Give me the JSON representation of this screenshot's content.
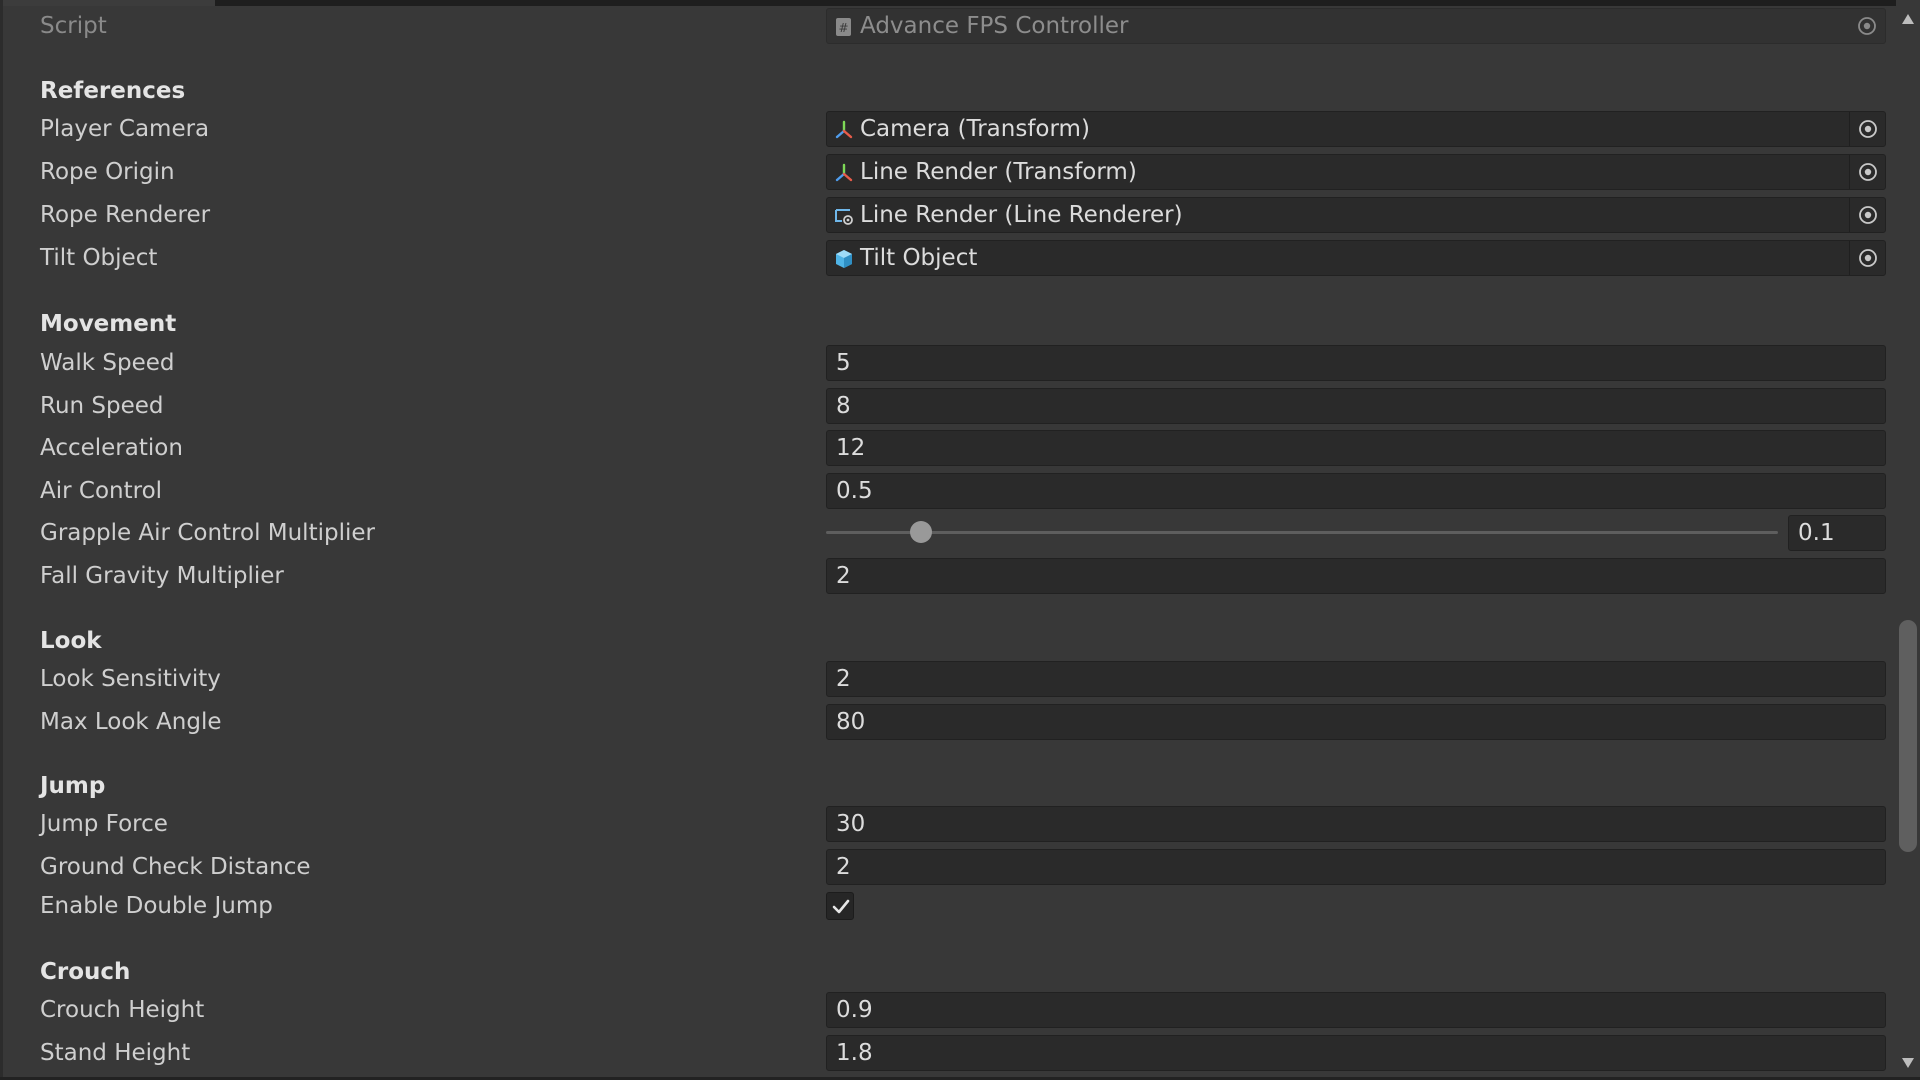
{
  "script": {
    "label": "Script",
    "value": "Advance FPS Controller",
    "icon": "script-icon"
  },
  "sections": {
    "references": {
      "header": "References",
      "player_camera": {
        "label": "Player Camera",
        "value": "Camera (Transform)",
        "icon": "transform-icon"
      },
      "rope_origin": {
        "label": "Rope Origin",
        "value": "Line Render (Transform)",
        "icon": "transform-icon"
      },
      "rope_renderer": {
        "label": "Rope Renderer",
        "value": "Line Render (Line Renderer)",
        "icon": "line-renderer-icon"
      },
      "tilt_object": {
        "label": "Tilt Object",
        "value": "Tilt Object",
        "icon": "gameobject-icon"
      }
    },
    "movement": {
      "header": "Movement",
      "walk_speed": {
        "label": "Walk Speed",
        "value": "5"
      },
      "run_speed": {
        "label": "Run Speed",
        "value": "8"
      },
      "acceleration": {
        "label": "Acceleration",
        "value": "12"
      },
      "air_control": {
        "label": "Air Control",
        "value": "0.5"
      },
      "grapple_air_control_multiplier": {
        "label": "Grapple Air Control Multiplier",
        "value": "0.1",
        "slider_fraction": 0.1
      },
      "fall_gravity_multiplier": {
        "label": "Fall Gravity Multiplier",
        "value": "2"
      }
    },
    "look": {
      "header": "Look",
      "look_sensitivity": {
        "label": "Look Sensitivity",
        "value": "2"
      },
      "max_look_angle": {
        "label": "Max Look Angle",
        "value": "80"
      }
    },
    "jump": {
      "header": "Jump",
      "jump_force": {
        "label": "Jump Force",
        "value": "30"
      },
      "ground_check_distance": {
        "label": "Ground Check Distance",
        "value": "2"
      },
      "enable_double_jump": {
        "label": "Enable Double Jump",
        "checked": true
      }
    },
    "crouch": {
      "header": "Crouch",
      "crouch_height": {
        "label": "Crouch Height",
        "value": "0.9"
      },
      "stand_height": {
        "label": "Stand Height",
        "value": "1.8"
      }
    }
  },
  "colors": {
    "background": "#383838",
    "field_bg": "#2a2a2a",
    "text": "#d2d2d2",
    "gameobject_icon": "#4fb4e6"
  }
}
